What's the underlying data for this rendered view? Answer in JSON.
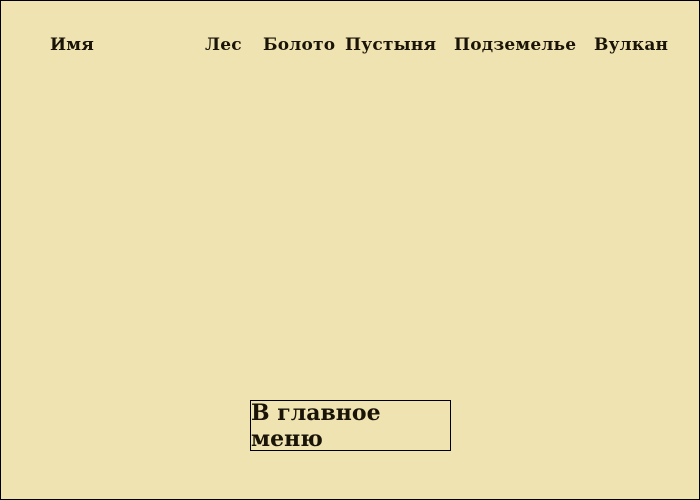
{
  "leaderboard": {
    "columns": {
      "name": "Имя",
      "forest": "Лес",
      "swamp": "Болото",
      "desert": "Пустыня",
      "dungeon": "Подземелье",
      "volcano": "Вулкан"
    },
    "rows": []
  },
  "main_menu_button": "В главное меню",
  "colors": {
    "background": "#efe3b2",
    "text": "#1a1408",
    "border": "#000000"
  }
}
